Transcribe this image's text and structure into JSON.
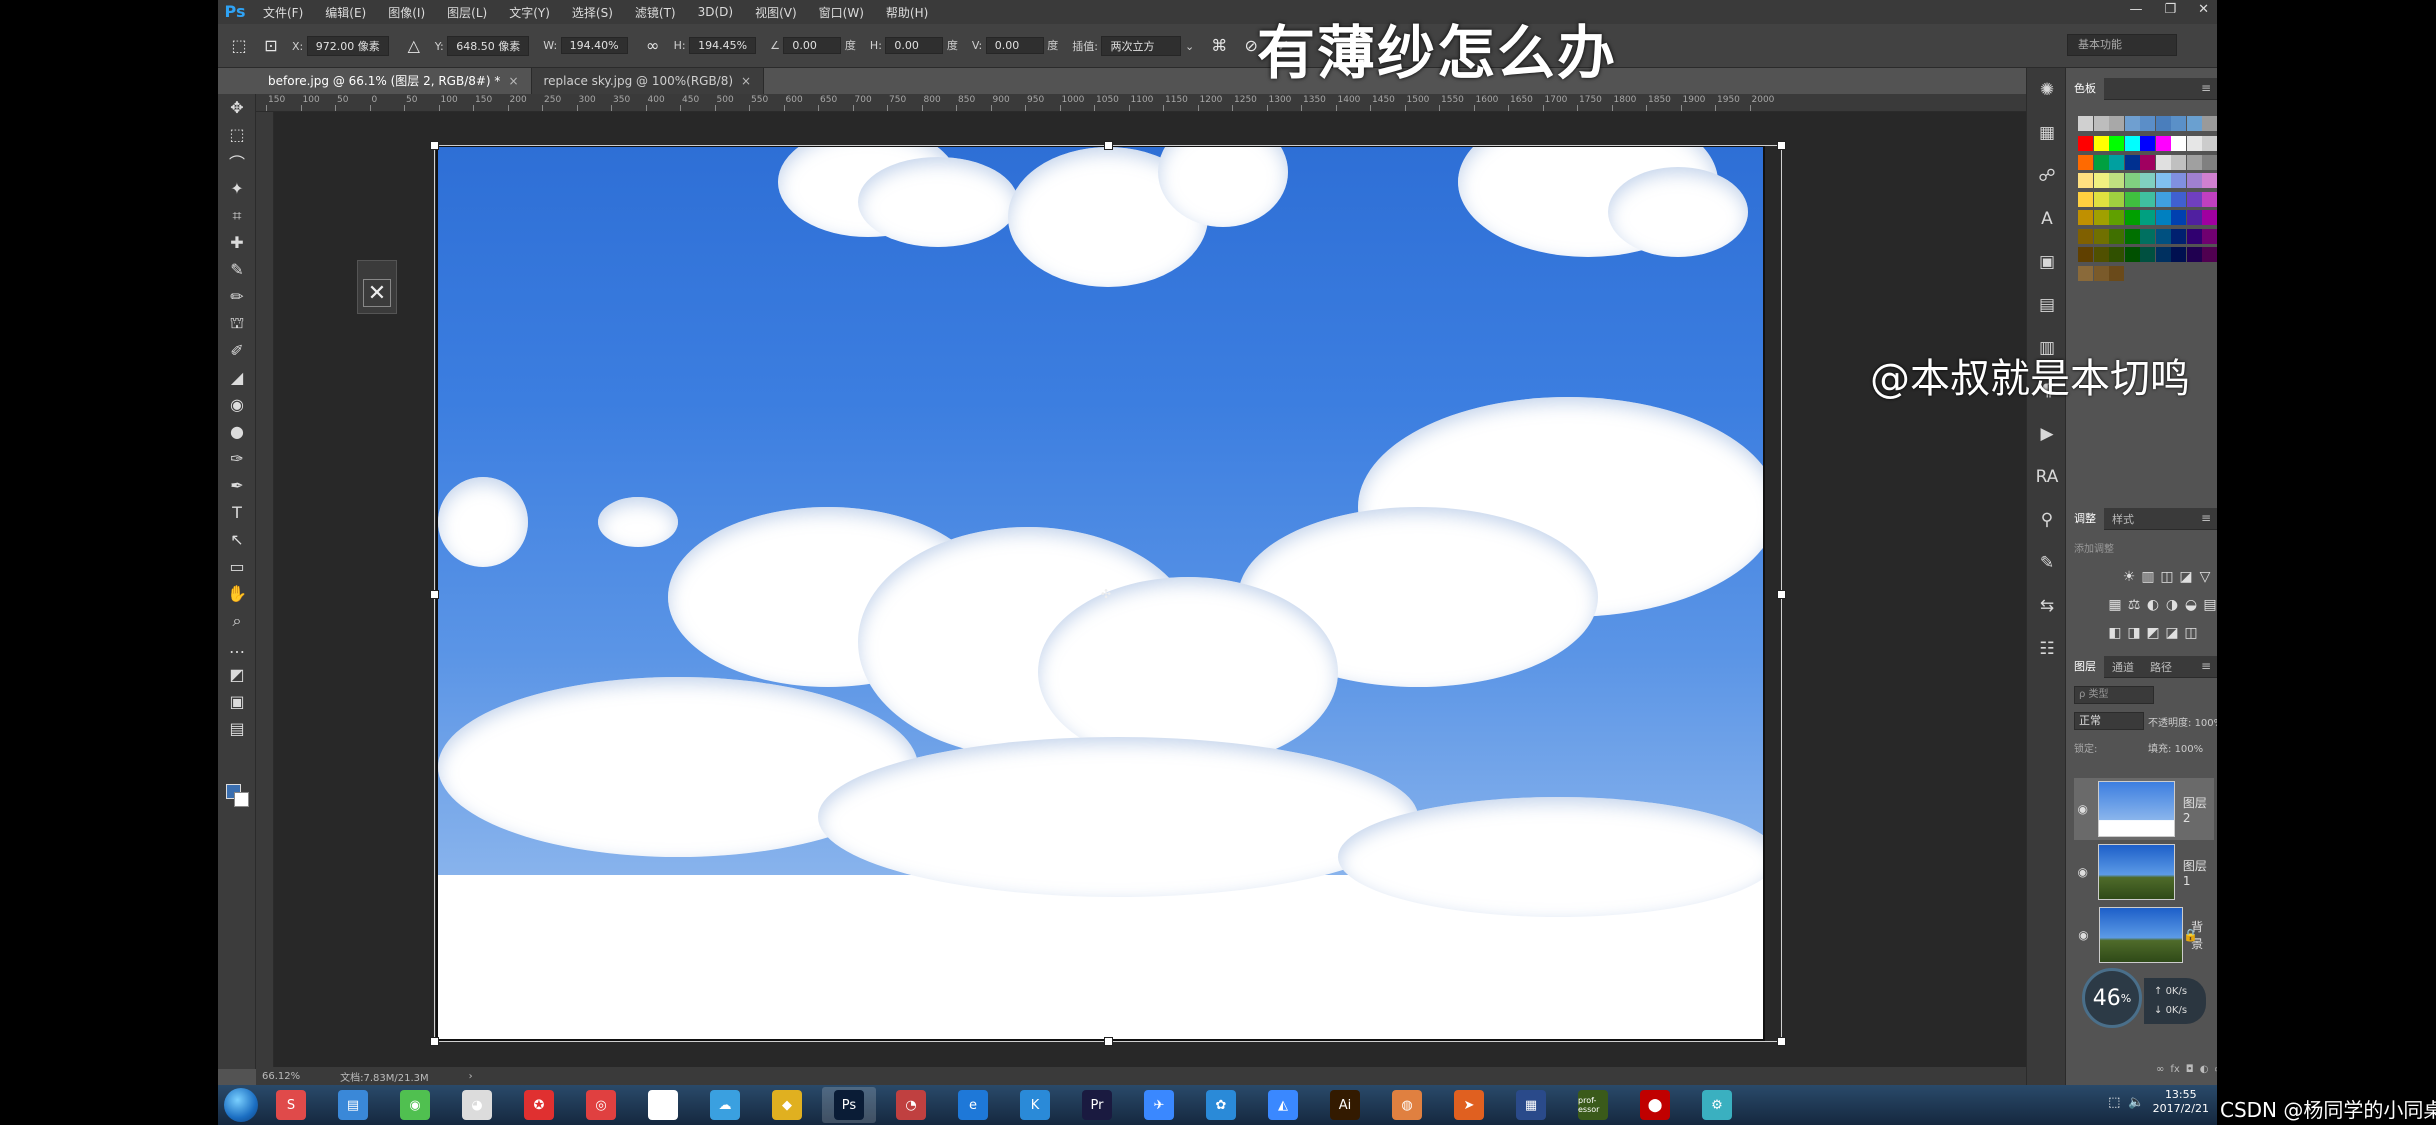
{
  "menubar": {
    "logo": "Ps",
    "items": [
      "文件(F)",
      "编辑(E)",
      "图像(I)",
      "图层(L)",
      "文字(Y)",
      "选择(S)",
      "滤镜(T)",
      "3D(D)",
      "视图(V)",
      "窗口(W)",
      "帮助(H)"
    ],
    "window_controls": [
      "—",
      "❐",
      "✕"
    ]
  },
  "options": {
    "x_label": "X:",
    "x_value": "972.00 像素",
    "y_label": "Y:",
    "y_value": "648.50 像素",
    "w_label": "W:",
    "w_value": "194.40%",
    "h_label": "H:",
    "h_value": "194.45%",
    "angle_value": "0.00",
    "angle_unit": "度",
    "hskew_label": "H:",
    "hskew_value": "0.00",
    "hskew_unit": "度",
    "vskew_label": "V:",
    "vskew_value": "0.00",
    "vskew_unit": "度",
    "interp_label": "插值:",
    "interp_value": "两次立方",
    "workspace": "基本功能"
  },
  "overlay": {
    "title": "有薄纱怎么办",
    "handle": "@本叔就是本切鸣",
    "watermark": "CSDN @杨同学的小同桌"
  },
  "tabs": [
    {
      "label": "before.jpg @ 66.1% (图层 2, RGB/8#) *",
      "close": "×"
    },
    {
      "label": "replace sky.jpg @ 100%(RGB/8)",
      "close": "×"
    }
  ],
  "ruler": {
    "ticks": [
      "150",
      "100",
      "50",
      "0",
      "50",
      "100",
      "150",
      "200",
      "250",
      "300",
      "350",
      "400",
      "450",
      "500",
      "550",
      "600",
      "650",
      "700",
      "750",
      "800",
      "850",
      "900",
      "950",
      "1000",
      "1050",
      "1100",
      "1150",
      "1200",
      "1250",
      "1300",
      "1350",
      "1400",
      "1450",
      "1500",
      "1550",
      "1600",
      "1650",
      "1700",
      "1750",
      "1800",
      "1850",
      "1900",
      "1950",
      "2000"
    ]
  },
  "statusbar": {
    "zoom": "66.12%",
    "doc": "文档:7.83M/21.3M",
    "arrow": "›"
  },
  "panels": {
    "swatches_tab": "色板",
    "adjust_tabs": [
      "调整",
      "样式"
    ],
    "adjust_add": "添加调整",
    "layers_tabs": [
      "图层",
      "通道",
      "路径"
    ],
    "layer_filter": "ρ 类型",
    "blend_mode": "正常",
    "opacity_label": "不透明度:",
    "opacity_value": "100%",
    "lock_label": "锁定:",
    "fill_label": "填充:",
    "fill_value": "100%",
    "layers": [
      {
        "name": "图层 2",
        "selected": true
      },
      {
        "name": "图层 1",
        "selected": false
      },
      {
        "name": "背景",
        "selected": false,
        "locked": true
      }
    ],
    "menu_icon": "≡",
    "bottom_icons": [
      "∞",
      "fx",
      "◘",
      "◐",
      "▭",
      "⊞",
      "🗑"
    ]
  },
  "gauge": {
    "value": "46",
    "unit": "%",
    "up": "0K/s",
    "down": "0K/s"
  },
  "mini_strip": [
    "✺",
    "▦",
    "☍",
    "A",
    "▣",
    "▤",
    "▥",
    "¶",
    "▶",
    "RA",
    "⚲",
    "✎",
    "⇆",
    "☷"
  ],
  "tools": [
    "✥",
    "⬚",
    "⌒",
    "✦",
    "⌗",
    "✚",
    "✎",
    "✏",
    "⛫",
    "✐",
    "◢",
    "◉",
    "●",
    "✑",
    "✒",
    "T",
    "↖",
    "▭",
    "✋",
    "⌕",
    "…",
    "◩",
    "▣",
    "▤"
  ],
  "taskbar": {
    "icons": [
      "S",
      "▤",
      "◉",
      "◕",
      "✪",
      "◎",
      "▢",
      "☁",
      "◆",
      "Ps",
      "◔",
      "e",
      "K",
      "Pr",
      "✈",
      "✿",
      "◭",
      "Ai",
      "◍",
      "➤",
      "▦",
      "prof-essor",
      "⬤",
      "⚙"
    ],
    "active_index": 9,
    "clock_time": "13:55",
    "clock_date": "2017/2/21"
  },
  "colors": {
    "ps_blue": "#2fa3f5",
    "sky_top": "#2e6fd6",
    "sky_bottom": "#88b3ec",
    "panel_bg": "#535353",
    "taskbar": "#15283f"
  }
}
